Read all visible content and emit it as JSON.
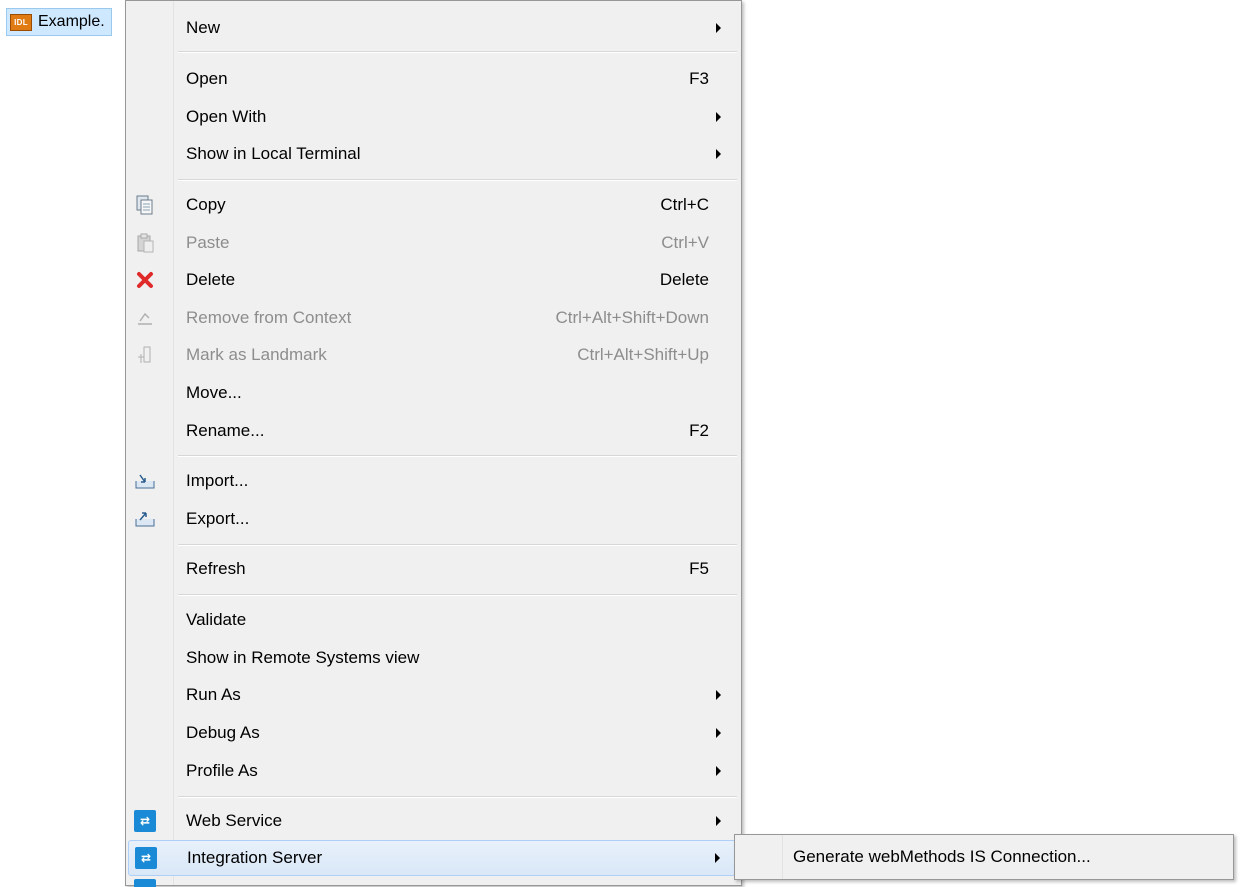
{
  "file": {
    "name": "Example.",
    "icon": "idl-file-icon",
    "icon_text": "IDL"
  },
  "menu": {
    "items": [
      {
        "label": "New",
        "shortcut": "",
        "submenu": true
      },
      {
        "label": "Open",
        "shortcut": "F3",
        "submenu": false
      },
      {
        "label": "Open With",
        "shortcut": "",
        "submenu": true
      },
      {
        "label": "Show in Local Terminal",
        "shortcut": "",
        "submenu": true
      },
      {
        "label": "Copy",
        "shortcut": "Ctrl+C",
        "icon": "copy-icon"
      },
      {
        "label": "Paste",
        "shortcut": "Ctrl+V",
        "icon": "paste-icon",
        "disabled": true
      },
      {
        "label": "Delete",
        "shortcut": "Delete",
        "icon": "delete-icon"
      },
      {
        "label": "Remove from Context",
        "shortcut": "Ctrl+Alt+Shift+Down",
        "icon": "remove-context-icon",
        "disabled": true
      },
      {
        "label": "Mark as Landmark",
        "shortcut": "Ctrl+Alt+Shift+Up",
        "icon": "landmark-icon",
        "disabled": true
      },
      {
        "label": "Move...",
        "shortcut": ""
      },
      {
        "label": "Rename...",
        "shortcut": "F2"
      },
      {
        "label": "Import...",
        "shortcut": "",
        "icon": "import-icon"
      },
      {
        "label": "Export...",
        "shortcut": "",
        "icon": "export-icon"
      },
      {
        "label": "Refresh",
        "shortcut": "F5"
      },
      {
        "label": "Validate",
        "shortcut": ""
      },
      {
        "label": "Show in Remote Systems view",
        "shortcut": ""
      },
      {
        "label": "Run As",
        "shortcut": "",
        "submenu": true
      },
      {
        "label": "Debug As",
        "shortcut": "",
        "submenu": true
      },
      {
        "label": "Profile As",
        "shortcut": "",
        "submenu": true
      },
      {
        "label": "Web Service",
        "shortcut": "",
        "submenu": true,
        "icon": "web-service-icon"
      },
      {
        "label": "Integration Server",
        "shortcut": "",
        "submenu": true,
        "icon": "integration-server-icon",
        "highlighted": true
      }
    ]
  },
  "submenu": {
    "items": [
      {
        "label": "Generate webMethods IS Connection..."
      }
    ]
  },
  "colors": {
    "menu_bg": "#f0f0f0",
    "highlight_border": "#aecff7",
    "disabled_text": "#8d8d8d",
    "delete_icon": "#e02a2a",
    "service_icon": "#1a8ad6"
  }
}
